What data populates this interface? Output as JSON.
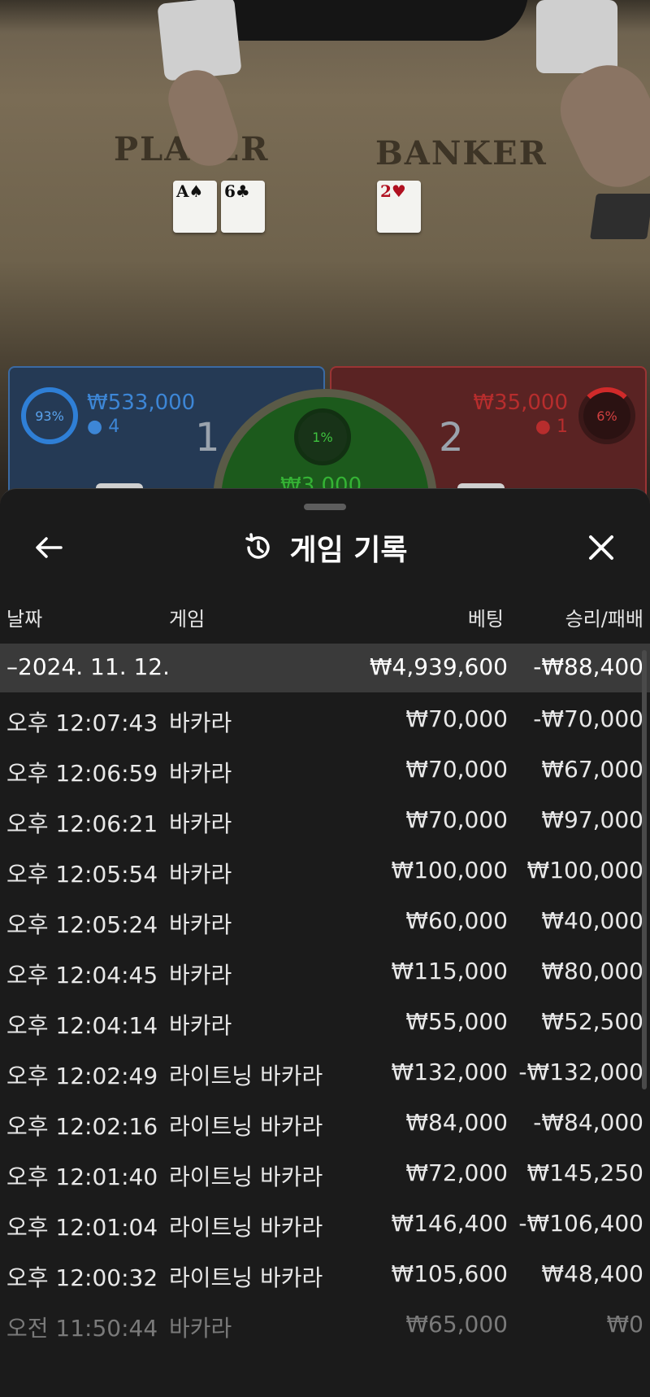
{
  "scene": {
    "felt_player": "PLAYER",
    "felt_banker": "BANKER",
    "cards_player": [
      {
        "rank": "A",
        "suit": "♠",
        "color": "black"
      },
      {
        "rank": "6",
        "suit": "♣",
        "color": "black"
      }
    ],
    "cards_banker": [
      {
        "rank": "2",
        "suit": "♥",
        "color": "red"
      }
    ],
    "player_bet": {
      "percent": "93%",
      "amount": "₩533,000",
      "players": "4",
      "score": "1"
    },
    "banker_bet": {
      "percent": "6%",
      "amount": "₩35,000",
      "players": "1",
      "score": "2"
    },
    "tie_bet": {
      "percent": "1%",
      "amount": "₩3,000"
    }
  },
  "sheet": {
    "title": "게임 기록",
    "back_icon": "arrow-left-icon",
    "history_icon": "history-icon",
    "close_icon": "close-icon",
    "columns": {
      "date": "날짜",
      "game": "게임",
      "bet": "베팅",
      "result": "승리/패배"
    },
    "summary": {
      "date": "–2024. 11. 12.",
      "bet": "₩4,939,600",
      "result": "-₩88,400"
    },
    "rows": [
      {
        "time": "오후 12:07:43",
        "game": "바카라",
        "bet": "₩70,000",
        "result": "-₩70,000"
      },
      {
        "time": "오후 12:06:59",
        "game": "바카라",
        "bet": "₩70,000",
        "result": "₩67,000"
      },
      {
        "time": "오후 12:06:21",
        "game": "바카라",
        "bet": "₩70,000",
        "result": "₩97,000"
      },
      {
        "time": "오후 12:05:54",
        "game": "바카라",
        "bet": "₩100,000",
        "result": "₩100,000"
      },
      {
        "time": "오후 12:05:24",
        "game": "바카라",
        "bet": "₩60,000",
        "result": "₩40,000"
      },
      {
        "time": "오후 12:04:45",
        "game": "바카라",
        "bet": "₩115,000",
        "result": "₩80,000"
      },
      {
        "time": "오후 12:04:14",
        "game": "바카라",
        "bet": "₩55,000",
        "result": "₩52,500"
      },
      {
        "time": "오후 12:02:49",
        "game": "라이트닝 바카라",
        "bet": "₩132,000",
        "result": "-₩132,000"
      },
      {
        "time": "오후 12:02:16",
        "game": "라이트닝 바카라",
        "bet": "₩84,000",
        "result": "-₩84,000"
      },
      {
        "time": "오후 12:01:40",
        "game": "라이트닝 바카라",
        "bet": "₩72,000",
        "result": "₩145,250"
      },
      {
        "time": "오후 12:01:04",
        "game": "라이트닝 바카라",
        "bet": "₩146,400",
        "result": "-₩106,400"
      },
      {
        "time": "오후 12:00:32",
        "game": "라이트닝 바카라",
        "bet": "₩105,600",
        "result": "₩48,400"
      },
      {
        "time": "오전 11:50:44",
        "game": "바카라",
        "bet": "₩65,000",
        "result": "₩0"
      }
    ]
  }
}
